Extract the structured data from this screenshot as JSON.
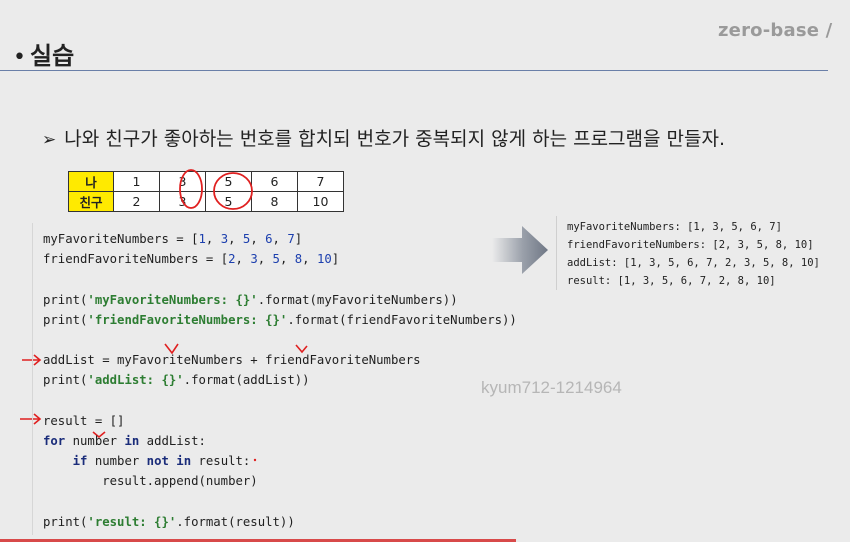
{
  "brand": {
    "logo_text": "zero-base /"
  },
  "slide": {
    "title": "실습",
    "subtitle": "나와 친구가 좋아하는 번호를 합치되 번호가 중복되지 않게 하는 프로그램을 만들자."
  },
  "number_table": {
    "rows": [
      {
        "label": "나",
        "values": [
          "1",
          "3",
          "5",
          "6",
          "7"
        ]
      },
      {
        "label": "친구",
        "values": [
          "2",
          "3",
          "5",
          "8",
          "10"
        ]
      }
    ]
  },
  "code": {
    "line1": {
      "name": "myFavoriteNumbers",
      "op": " = [",
      "n1": "1",
      "n2": "3",
      "n3": "5",
      "n4": "6",
      "n5": "7",
      "close": "]"
    },
    "line2": {
      "name": "friendFavoriteNumbers",
      "op": " = [",
      "n1": "2",
      "n2": "3",
      "n3": "5",
      "n4": "8",
      "n5": "10",
      "close": "]"
    },
    "line3": {
      "fn": "print(",
      "str": "'myFavoriteNumbers: {}'",
      "rest": ".format(myFavoriteNumbers))"
    },
    "line4": {
      "fn": "print(",
      "str": "'friendFavoriteNumbers: {}'",
      "rest": ".format(friendFavoriteNumbers))"
    },
    "line5": {
      "text": "addList = myFavoriteNumbers + friendFavoriteNumbers"
    },
    "line6": {
      "fn": "print(",
      "str": "'addList: {}'",
      "rest": ".format(addList))"
    },
    "line7": {
      "text": "result = []"
    },
    "line8": {
      "kw1": "for",
      "mid": " number ",
      "kw2": "in",
      "rest": " addList:"
    },
    "line9": {
      "indent": "    ",
      "kw1": "if",
      "mid": " number ",
      "kw2": "not in",
      "rest": " result:"
    },
    "line10": {
      "text": "        result.append(number)"
    },
    "line11": {
      "fn": "print(",
      "str": "'result: {}'",
      "rest": ".format(result))"
    }
  },
  "output": {
    "lines": [
      "myFavoriteNumbers: [1, 3, 5, 6, 7]",
      "friendFavoriteNumbers: [2, 3, 5, 8, 10]",
      "addList: [1, 3, 5, 6, 7, 2, 3, 5, 8, 10]",
      "result: [1, 3, 5, 6, 7, 2, 8, 10]"
    ]
  },
  "watermark": {
    "text": "kyum712-1214964"
  },
  "colors": {
    "highlight": "#ffea00",
    "annotation_red": "#e02020",
    "string_green": "#2d7d32",
    "number_blue": "#1c3fae",
    "keyword_navy": "#1a2c7a"
  }
}
